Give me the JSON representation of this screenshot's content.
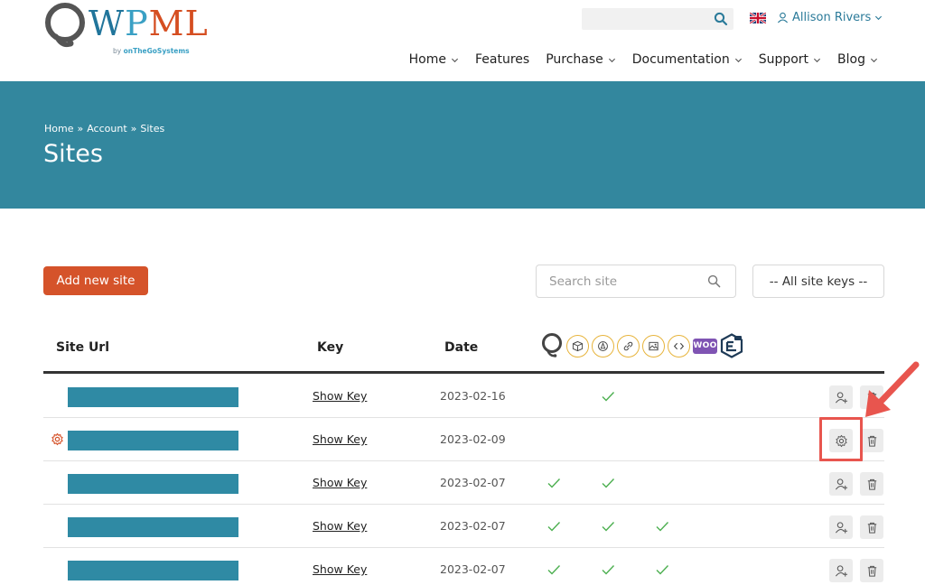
{
  "brand": {
    "logo_w": "W",
    "logo_p": "P",
    "logo_ml": "ML",
    "by_text": "by",
    "company": "onTheGoSystems"
  },
  "topbar": {
    "search_placeholder": "",
    "user_name": "Allison Rivers"
  },
  "nav": [
    {
      "label": "Home",
      "has_dropdown": true
    },
    {
      "label": "Features",
      "has_dropdown": false
    },
    {
      "label": "Purchase",
      "has_dropdown": true
    },
    {
      "label": "Documentation",
      "has_dropdown": true
    },
    {
      "label": "Support",
      "has_dropdown": true
    },
    {
      "label": "Blog",
      "has_dropdown": true
    }
  ],
  "breadcrumb": {
    "items": [
      "Home",
      "Account",
      "Sites"
    ],
    "separator": "»"
  },
  "page_title": "Sites",
  "toolbar": {
    "add_label": "Add new site",
    "search_placeholder": "Search site",
    "keys_select": "-- All site keys --"
  },
  "table": {
    "headers": {
      "url": "Site Url",
      "key": "Key",
      "date": "Date"
    },
    "column_icons": [
      "wpml-icon",
      "box-icon",
      "pen-icon",
      "link-icon",
      "image-icon",
      "code-icon",
      "woo-icon",
      "media-translation-icon"
    ],
    "woo_label": "WOO",
    "rows": [
      {
        "show_key": "Show Key",
        "date": "2023-02-16",
        "checks": [
          false,
          false,
          false,
          true,
          false,
          false,
          false,
          false
        ],
        "settings_icon": false
      },
      {
        "show_key": "Show Key",
        "date": "2023-02-09",
        "checks": [
          false,
          false,
          false,
          false,
          false,
          false,
          false,
          false
        ],
        "settings_icon": true
      },
      {
        "show_key": "Show Key",
        "date": "2023-02-07",
        "checks": [
          false,
          true,
          false,
          true,
          false,
          false,
          false,
          false
        ],
        "settings_icon": false
      },
      {
        "show_key": "Show Key",
        "date": "2023-02-07",
        "checks": [
          false,
          true,
          false,
          true,
          false,
          true,
          false,
          false
        ],
        "settings_icon": false
      },
      {
        "show_key": "Show Key",
        "date": "2023-02-07",
        "checks": [
          false,
          true,
          false,
          true,
          false,
          true,
          false,
          false
        ],
        "settings_icon": false
      }
    ]
  },
  "colors": {
    "hero": "#33879e",
    "accent": "#d5532a",
    "check": "#4caf50",
    "highlight": "#e8554e",
    "ring": "#e7b43c"
  }
}
